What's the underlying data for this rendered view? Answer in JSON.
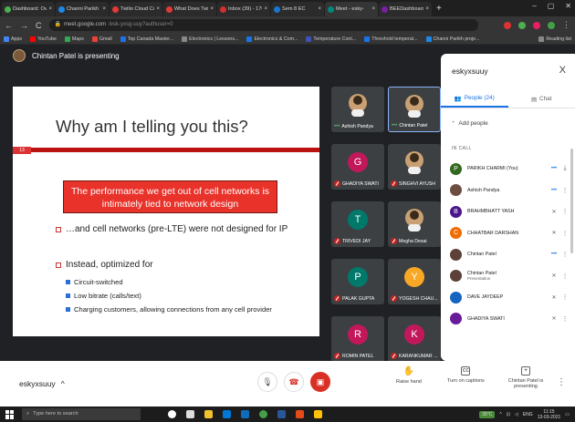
{
  "browser": {
    "tabs": [
      {
        "label": "Dashboard: Overv",
        "color": "#4caf50",
        "active": false
      },
      {
        "label": "Channi Parikh pr",
        "color": "#1e88e5",
        "active": false
      },
      {
        "label": "Twilio Cloud Com",
        "color": "#e53935",
        "active": false
      },
      {
        "label": "What Does Twilio",
        "color": "#e53935",
        "active": false
      },
      {
        "label": "Inbox (39) - 1701",
        "color": "#d32f2f",
        "active": false
      },
      {
        "label": "Sem 8 EC",
        "color": "#1976d2",
        "active": false
      },
      {
        "label": "Meet - esky-",
        "color": "#00897b",
        "active": true
      },
      {
        "label": "BEEDashboardc.fo",
        "color": "#7b1fa2",
        "active": false
      }
    ],
    "new_tab": "+",
    "window_controls": [
      "–",
      "▢",
      "✕"
    ],
    "url_host": "meet.google.com",
    "url_path": "/esk-yxsg-uuy?authuser=0",
    "bookmarks": [
      {
        "label": "Apps",
        "color": "#4285f4"
      },
      {
        "label": "YouTube",
        "color": "#ff0000"
      },
      {
        "label": "Maps",
        "color": "#34a853"
      },
      {
        "label": "Gmail",
        "color": "#ea4335"
      },
      {
        "label": "Top Canada Master...",
        "color": "#1a73e8"
      },
      {
        "label": "Electronics | Lessons...",
        "color": "#888888"
      },
      {
        "label": "Electronics & Com...",
        "color": "#1a73e8"
      },
      {
        "label": "Temperature Cont...",
        "color": "#3f51b5"
      },
      {
        "label": "Threshold temperat...",
        "color": "#1a73e8"
      },
      {
        "label": "Channi Parikh proje...",
        "color": "#1e88e5"
      }
    ],
    "reading_list": "Reading list"
  },
  "meet": {
    "presenter_text": "Chintan Patel is presenting",
    "slide": {
      "title": "Why am I telling you this?",
      "number": "13",
      "highlight": "The performance we get out of cell networks is intimately tied to network design",
      "bullet1": "…and cell networks (pre-LTE) were not designed for IP",
      "bullet2": "Instead, optimized for",
      "sub1": "Circuit-switched",
      "sub2": "Low bitrate (calls/text)",
      "sub3": "Charging customers, allowing connections from any cell provider"
    },
    "tiles": [
      {
        "name": "Ashish Pandya",
        "initial": "",
        "color": "",
        "state": "speaking"
      },
      {
        "name": "Chintan Patel",
        "initial": "",
        "color": "",
        "state": "speaking"
      },
      {
        "name": "GHADIYA SWATI",
        "initial": "G",
        "color": "#c2185b",
        "state": "muted"
      },
      {
        "name": "SINGHVI AYUSH",
        "initial": "",
        "color": "",
        "state": "muted"
      },
      {
        "name": "TRIVEDI JAY",
        "initial": "T",
        "color": "#00796b",
        "state": "muted"
      },
      {
        "name": "Megha Desai",
        "initial": "",
        "color": "",
        "state": "muted"
      },
      {
        "name": "PALAK GUPTA",
        "initial": "P",
        "color": "#00796b",
        "state": "muted"
      },
      {
        "name": "YOGESH CHAU...",
        "initial": "Y",
        "color": "#f9a825",
        "state": "muted"
      },
      {
        "name": "ROMIN PATEL",
        "initial": "R",
        "color": "#c2185b",
        "state": "muted"
      },
      {
        "name": "KARANKUMAR ...",
        "initial": "K",
        "color": "#c2185b",
        "state": "muted"
      }
    ]
  },
  "panel": {
    "meeting_code": "eskyxsuuy",
    "close": "X",
    "tab_people": "People (24)",
    "tab_chat": "Chat",
    "add_people": "Add people",
    "in_call": "IN CALL",
    "participants": [
      {
        "name": "PARIKH CHARMI (You)",
        "role": "",
        "initial": "P",
        "color": "#33691e",
        "icon": "•••",
        "icon2": "⤓"
      },
      {
        "name": "Ashish Pandya",
        "role": "",
        "initial": "",
        "color": "#6d4c41",
        "icon": "•••",
        "icon2": "⋮"
      },
      {
        "name": "BRAHMBHATT YASH",
        "role": "",
        "initial": "B",
        "color": "#4a148c",
        "icon": "✕",
        "icon2": "⋮"
      },
      {
        "name": "CHHATBAR DARSHAN",
        "role": "",
        "initial": "C",
        "color": "#ef6c00",
        "icon": "✕",
        "icon2": "⋮"
      },
      {
        "name": "Chintan Patel",
        "role": "",
        "initial": "",
        "color": "#5d4037",
        "icon": "•••",
        "icon2": "⋮"
      },
      {
        "name": "Chintan Patel",
        "role": "Presentation",
        "initial": "",
        "color": "#5d4037",
        "icon": "✕",
        "icon2": "⋮"
      },
      {
        "name": "DAVE JAYDEEP",
        "role": "",
        "initial": "",
        "color": "#1565c0",
        "icon": "✕",
        "icon2": "⋮"
      },
      {
        "name": "GHADIYA SWATI",
        "role": "",
        "initial": "",
        "color": "#6a1b9a",
        "icon": "✕",
        "icon2": "⋮"
      }
    ]
  },
  "toolbar": {
    "meeting_code": "eskyxsuuy",
    "chevron": "^",
    "raise_hand": "Raise hand",
    "captions": "Turn on captions",
    "presenting": "Chintan Patel is presenting",
    "more": "⋮"
  },
  "taskbar": {
    "search_placeholder": "Type here to search",
    "time": "11:15",
    "date": "13-03-2021",
    "temp": "35°C",
    "lang": "ENG"
  }
}
